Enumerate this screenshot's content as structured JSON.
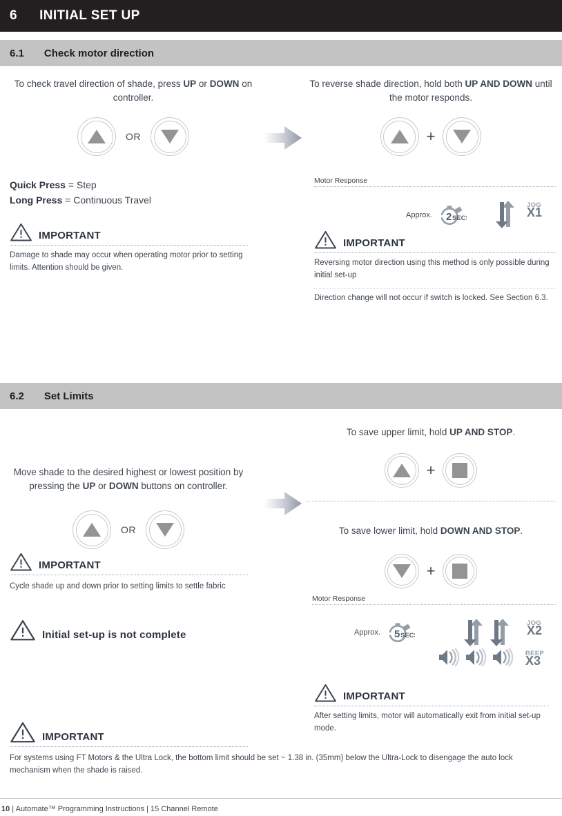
{
  "chapter": {
    "number": "6",
    "title": "INITIAL SET UP"
  },
  "sections": [
    {
      "number": "6.1",
      "title": "Check motor direction",
      "left": {
        "intro_pre": "To check travel direction of shade, press ",
        "intro_b1": "UP",
        "intro_mid": " or ",
        "intro_b2": "DOWN",
        "intro_post": " on controller.",
        "or_label": "OR",
        "press_quick_b": "Quick Press",
        "press_quick_t": " = Step",
        "press_long_b": "Long Press",
        "press_long_t": " = Continuous Travel",
        "important_word": "IMPORTANT",
        "important_body": "Damage to shade may occur when operating motor prior to setting limits. Attention should be given."
      },
      "right": {
        "intro_pre": "To reverse shade direction, hold both ",
        "intro_b1": "UP AND DOWN",
        "intro_post": " until the motor responds.",
        "joiner": "+",
        "motor_response_label": "Motor Response",
        "approx_label": "Approx.",
        "timer_value": "2",
        "timer_unit": "SECS",
        "jog_word": "JOG",
        "jog_count": "X1",
        "important_word": "IMPORTANT",
        "important_body_1": "Reversing motor direction using this method is only possible during initial set-up",
        "important_body_2": "Direction change will not occur if switch is locked. See Section 6.3."
      }
    },
    {
      "number": "6.2",
      "title": "Set Limits",
      "left": {
        "intro_pre": "Move shade to the desired highest or lowest position by pressing the ",
        "intro_b1": "UP",
        "intro_mid": " or ",
        "intro_b2": "DOWN",
        "intro_post": " buttons on controller.",
        "or_label": "OR",
        "important_word_1": "IMPORTANT",
        "important_body_1": "Cycle shade up and down prior to setting limits to settle fabric",
        "important_word_2": "Initial set-up is not complete",
        "important_word_3": "IMPORTANT",
        "important_body_3": "For systems using FT Motors & the Ultra Lock, the bottom limit should be set ~ 1.38 in. (35mm) below the Ultra-Lock to disengage the auto lock mechanism when the shade is raised."
      },
      "right": {
        "upper_pre": "To save upper limit, hold ",
        "upper_b": "UP AND STOP",
        "upper_post": ".",
        "lower_pre": "To save lower limit, hold ",
        "lower_b": "DOWN AND STOP",
        "lower_post": ".",
        "joiner": "+",
        "motor_response_label": "Motor Response",
        "approx_label": "Approx.",
        "timer_value": "5",
        "timer_unit": "SECS",
        "jog_word": "JOG",
        "jog_count": "X2",
        "beep_word": "BEEP",
        "beep_count": "X3",
        "important_word": "IMPORTANT",
        "important_body": "After setting limits, motor will automatically exit from initial set-up mode."
      }
    }
  ],
  "footer": {
    "page_number": "10",
    "text": " | Automate™ Programming Instructions | 15 Channel Remote"
  },
  "colors": {
    "chapter_bar": "#231f20",
    "section_bar": "#c3c3c3",
    "body_text": "#3d4650",
    "icon_gray": "#949ea8",
    "button_ring": "#c9c9c9",
    "glyph_gray": "#949494"
  }
}
